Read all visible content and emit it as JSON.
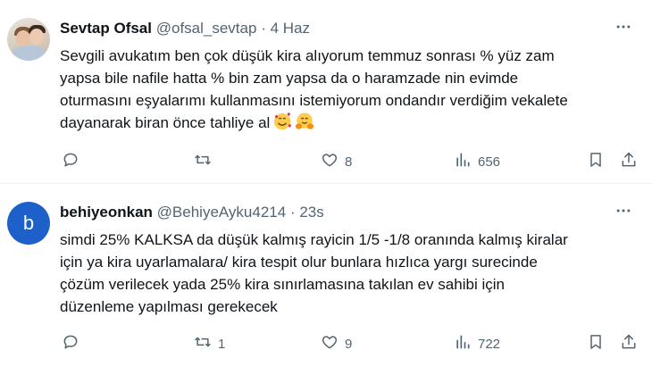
{
  "tweets": [
    {
      "name": "Sevtap Ofsal",
      "handle": "@ofsal_sevtap",
      "separator": "·",
      "time": "4 Haz",
      "text": "Sevgili avukatım ben çok düşük kira alıyorum temmuz sonrası % yüz zam\nyapsa bile nafile hatta % bin zam yapsa da o haramzade nin evimde\noturmasını eşyalarımı kullanmasını istemiyorum ondandır verdiğim vekalete\ndayanarak biran önce tahliye al",
      "emojis": [
        "smiling-face-with-hearts",
        "hugging-face"
      ],
      "replies": "",
      "retweets": "",
      "likes": "8",
      "views": "656"
    },
    {
      "avatar_letter": "b",
      "name": "behiyeonkan",
      "handle": "@BehiyeAyku4214",
      "separator": "·",
      "time": "23s",
      "text": "simdi 25% KALKSA da düşük kalmış rayicin 1/5 -1/8 oranında kalmış kiralar\niçin ya kira uyarlamalara/ kira tespit olur bunlara hızlıca yargı surecinde\nçözüm verilecek yada 25% kira sınırlamasına takılan ev sahibi için\ndüzenleme yapılması gerekecek",
      "replies": "",
      "retweets": "1",
      "likes": "9",
      "views": "722"
    }
  ],
  "colors": {
    "text": "#0f1419",
    "secondary": "#536471",
    "divider": "#eff3f4",
    "avatar_blue": "#1d60c9"
  },
  "icons": [
    "more-icon",
    "reply-icon",
    "retweet-icon",
    "like-icon",
    "views-icon",
    "bookmark-icon",
    "share-icon"
  ]
}
